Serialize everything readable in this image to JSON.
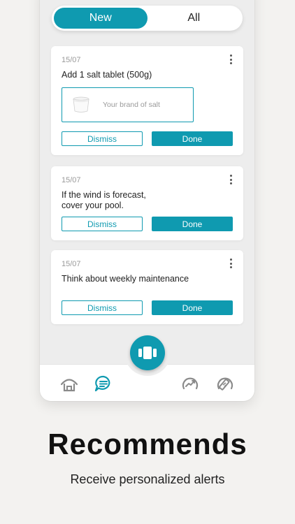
{
  "tabs": [
    {
      "label": "New",
      "active": true
    },
    {
      "label": "All",
      "active": false
    }
  ],
  "cards": [
    {
      "date": "15/07",
      "text": "Add 1 salt tablet (500g)",
      "product_label": "Your brand of salt",
      "dismiss_label": "Dismiss",
      "done_label": "Done"
    },
    {
      "date": "15/07",
      "text": "If the wind is forecast,\ncover your pool.",
      "dismiss_label": "Dismiss",
      "done_label": "Done"
    },
    {
      "date": "15/07",
      "text": "Think about weekly maintenance",
      "dismiss_label": "Dismiss",
      "done_label": "Done"
    }
  ],
  "nav": {
    "items": [
      {
        "icon": "home-icon",
        "active": false
      },
      {
        "icon": "chat-icon",
        "active": true
      },
      {
        "icon": "device-icon",
        "active": true
      },
      {
        "icon": "trend-icon",
        "active": false
      },
      {
        "icon": "test-strip-icon",
        "active": false
      }
    ]
  },
  "caption": {
    "headline": "Recommends",
    "subline": "Receive personalized alerts"
  },
  "colors": {
    "accent": "#0f9ab0",
    "background": "#f3f2f0",
    "screen": "#ededed"
  }
}
